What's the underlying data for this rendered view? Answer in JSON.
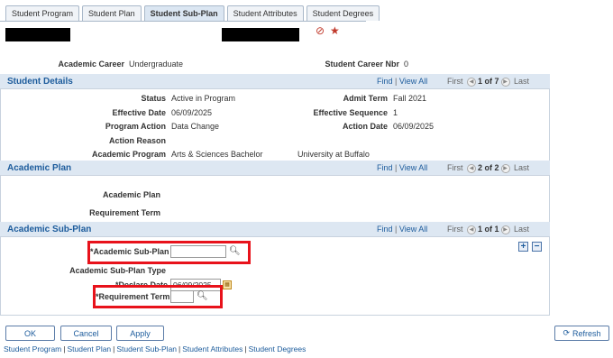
{
  "tabs": [
    {
      "label": "Student Program"
    },
    {
      "label": "Student Plan"
    },
    {
      "label": "Student Sub-Plan"
    },
    {
      "label": "Student Attributes"
    },
    {
      "label": "Student Degrees"
    }
  ],
  "header": {
    "career_label": "Academic Career",
    "career_value": "Undergraduate",
    "career_nbr_label": "Student Career Nbr",
    "career_nbr_value": "0"
  },
  "student_details": {
    "title": "Student Details",
    "find": "Find",
    "view_all": "View All",
    "first": "First",
    "position": "1 of 7",
    "last": "Last",
    "status_label": "Status",
    "status_value": "Active in Program",
    "admit_term_label": "Admit Term",
    "admit_term_value": "Fall 2021",
    "effective_date_label": "Effective Date",
    "effective_date_value": "06/09/2025",
    "effective_seq_label": "Effective Sequence",
    "effective_seq_value": "1",
    "program_action_label": "Program Action",
    "program_action_value": "Data Change",
    "action_date_label": "Action Date",
    "action_date_value": "06/09/2025",
    "action_reason_label": "Action Reason",
    "academic_program_label": "Academic Program",
    "academic_program_value": "Arts & Sciences Bachelor",
    "institution_value": "University at Buffalo"
  },
  "academic_plan": {
    "title": "Academic Plan",
    "find": "Find",
    "view_all": "View All",
    "first": "First",
    "position": "2 of 2",
    "last": "Last",
    "plan_label": "Academic Plan",
    "req_term_label": "Requirement Term"
  },
  "academic_sub_plan": {
    "title": "Academic Sub-Plan",
    "find": "Find",
    "view_all": "View All",
    "first": "First",
    "position": "1 of 1",
    "last": "Last",
    "sub_plan_label": "*Academic Sub-Plan",
    "sub_plan_value": "",
    "sub_plan_type_label": "Academic Sub-Plan Type",
    "declare_date_label": "*Declare Date",
    "declare_date_value": "06/09/2025",
    "req_term_label": "*Requirement Term",
    "req_term_value": "",
    "add_symbol": "+",
    "remove_symbol": "−"
  },
  "buttons": {
    "ok": "OK",
    "cancel": "Cancel",
    "apply": "Apply",
    "refresh": "Refresh"
  },
  "footer_links": [
    {
      "label": "Student Program"
    },
    {
      "label": "Student Plan"
    },
    {
      "label": "Student Sub-Plan"
    },
    {
      "label": "Student Attributes"
    },
    {
      "label": "Student Degrees"
    }
  ],
  "colors": {
    "accent": "#1d5c9c",
    "highlight": "#e8121b",
    "section_header": "#dde7f2"
  }
}
